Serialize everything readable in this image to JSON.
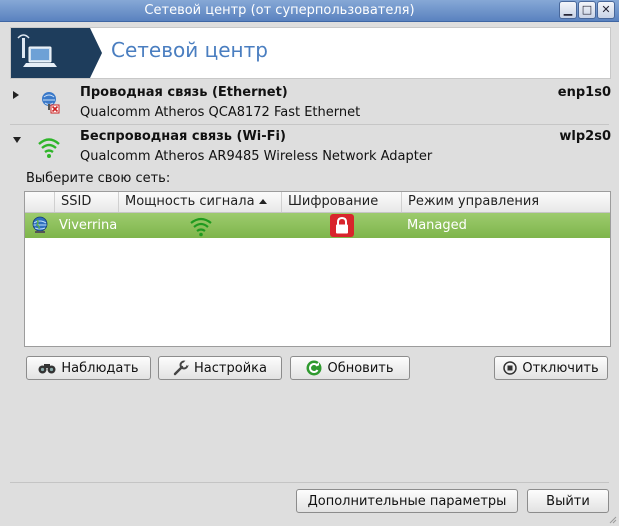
{
  "window": {
    "title": "Сетевой центр (от суперпользователя)"
  },
  "header": {
    "title": "Сетевой центр"
  },
  "ethernet": {
    "name": "Проводная связь (Ethernet)",
    "device": "Qualcomm Atheros QCA8172 Fast Ethernet",
    "interface": "enp1s0"
  },
  "wifi": {
    "name": "Беспроводная связь (Wi-Fi)",
    "device": "Qualcomm Atheros AR9485 Wireless Network Adapter",
    "interface": "wlp2s0",
    "choose_label": "Выберите свою сеть:",
    "columns": [
      "SSID",
      "Мощность сигнала",
      "Шифрование",
      "Режим управления"
    ],
    "networks": [
      {
        "ssid": "Viverrina",
        "signal_icon": "wifi-full-icon",
        "encryption_icon": "lock-icon",
        "mode": "Managed"
      }
    ]
  },
  "buttons": {
    "monitor": "Наблюдать",
    "configure": "Настройка",
    "refresh": "Обновить",
    "disconnect": "Отключить",
    "advanced": "Дополнительные параметры",
    "quit": "Выйти"
  },
  "colors": {
    "selected_row": "#88bd56",
    "header_title": "#4a7ec0",
    "banner_bg": "#1e3d5c",
    "wifi_green": "#2fb52a",
    "lock_red": "#d8252c"
  }
}
